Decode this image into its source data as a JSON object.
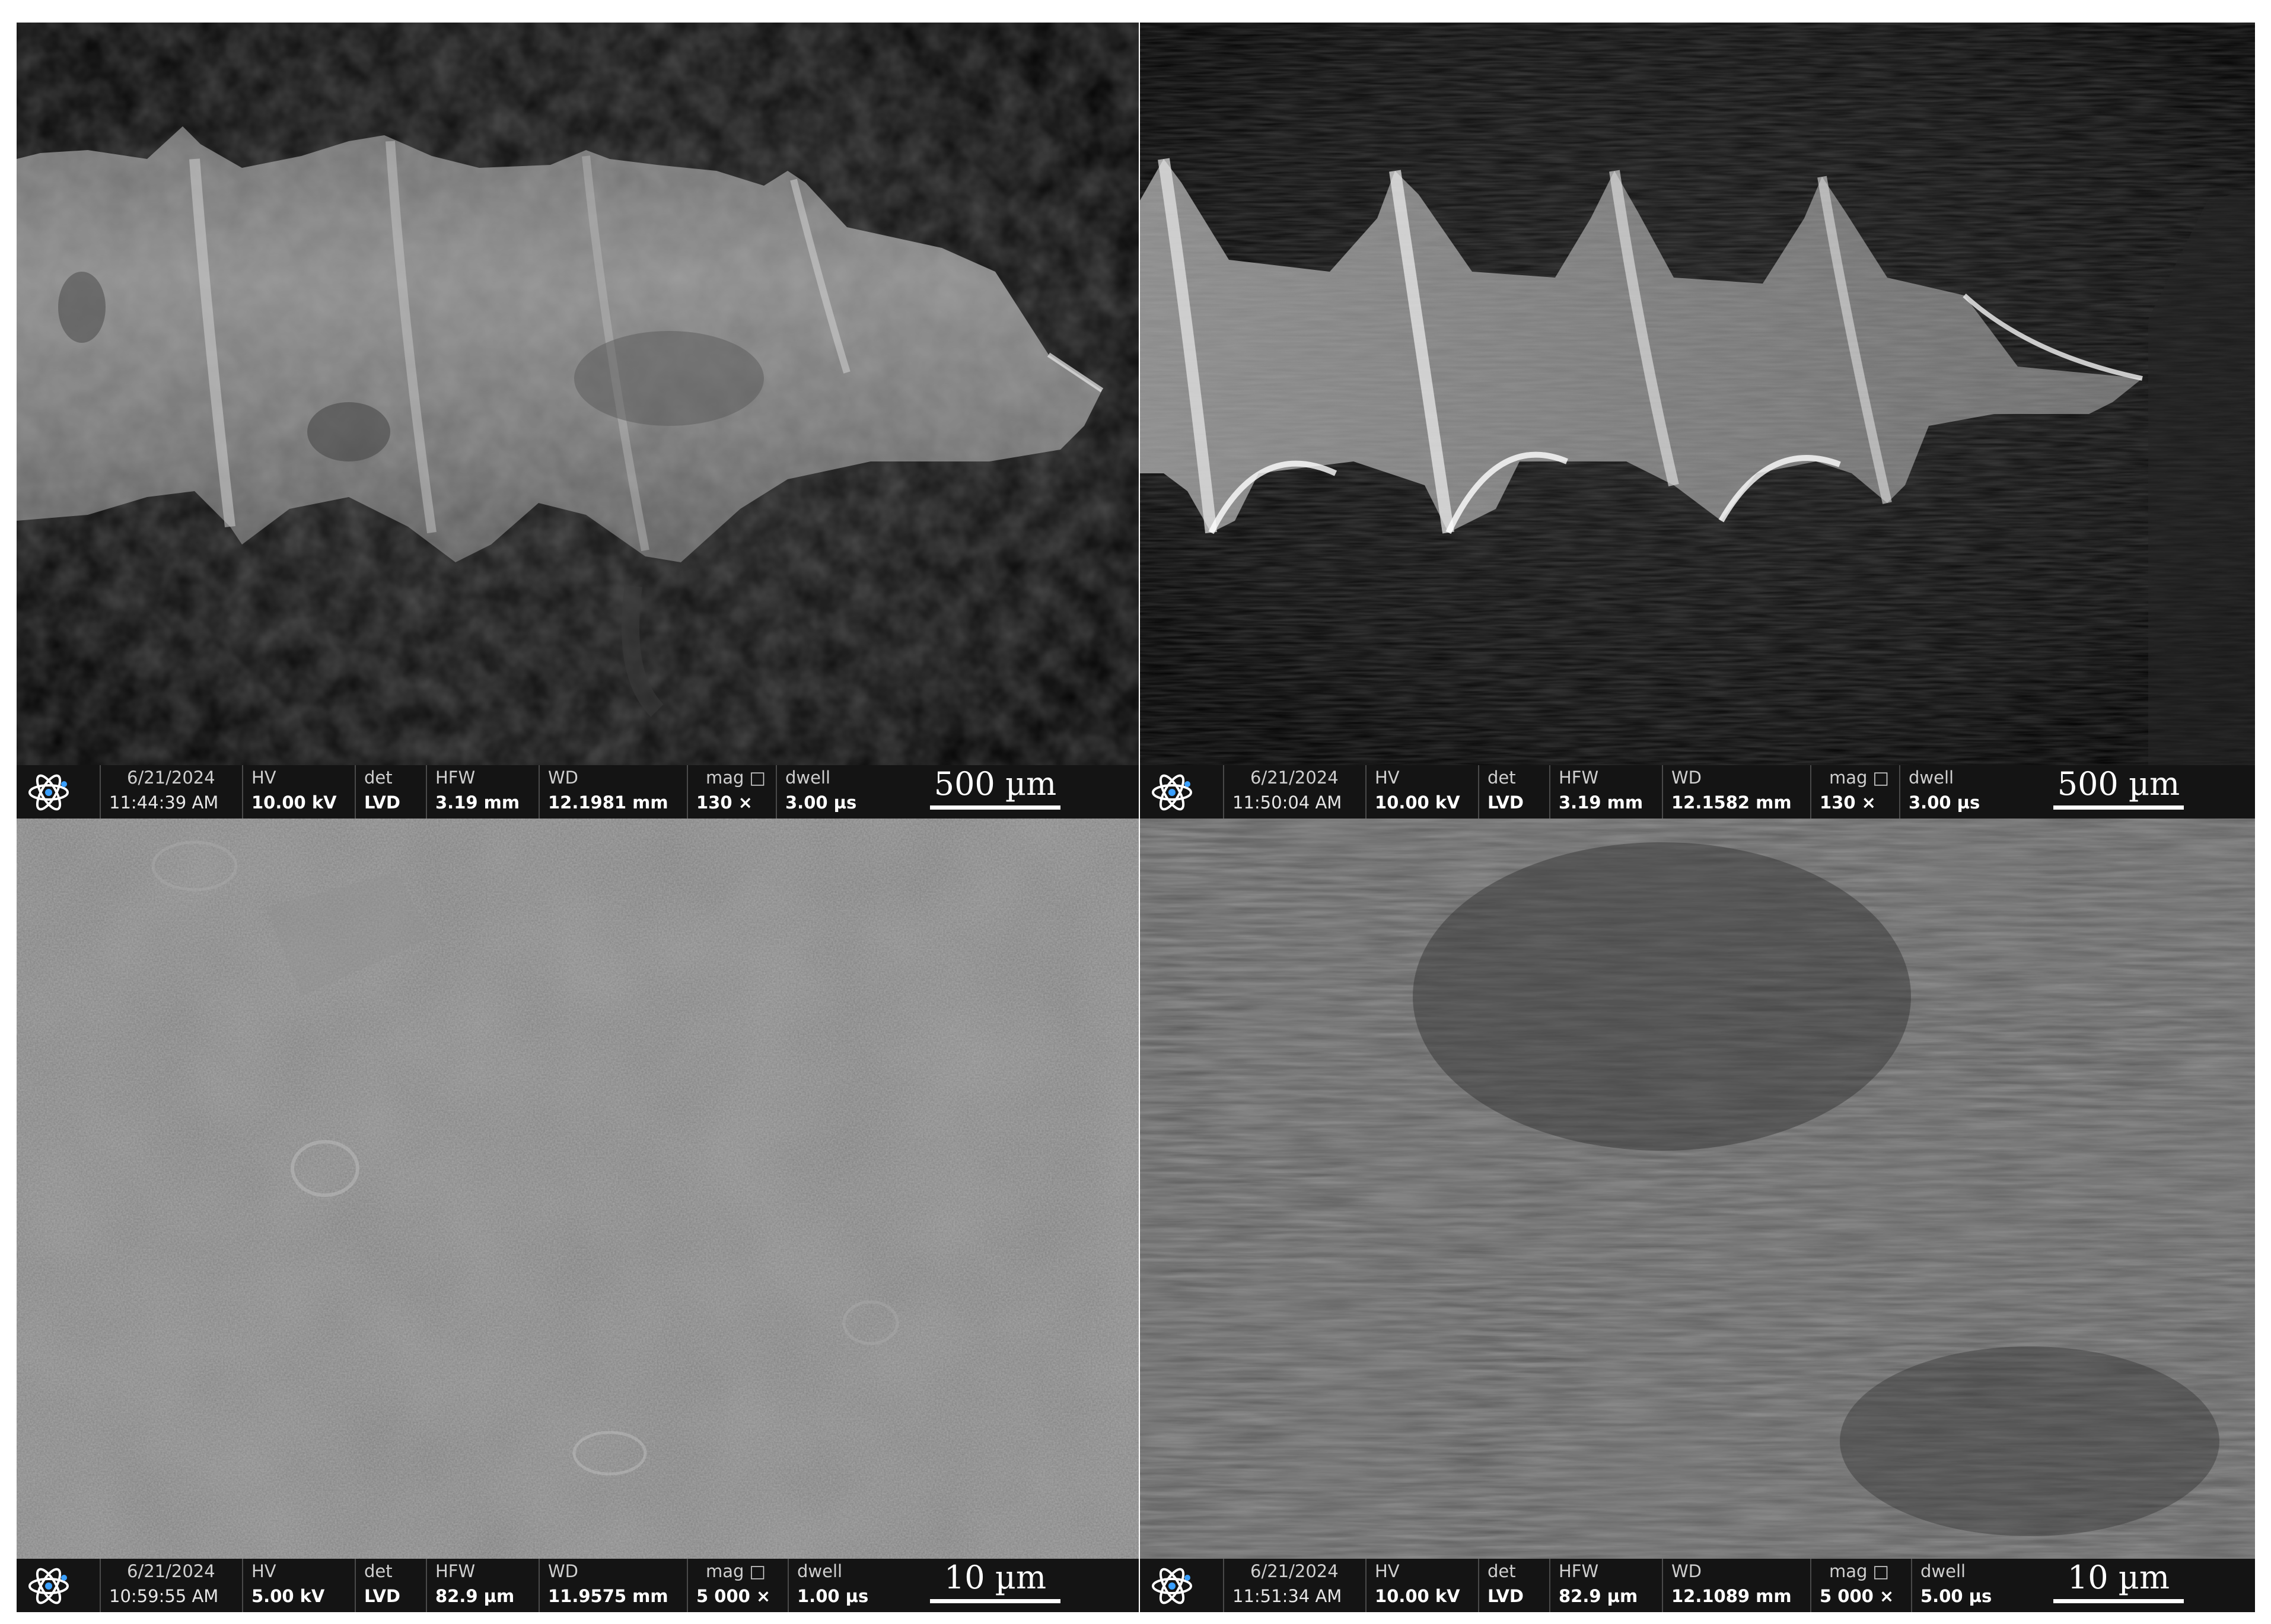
{
  "panels": [
    {
      "date": "6/21/2024",
      "time": "11:44:39 AM",
      "hv_label": "HV",
      "hv": "10.00 kV",
      "det_label": "det",
      "det": "LVD",
      "hfw_label": "HFW",
      "hfw": "3.19 mm",
      "wd_label": "WD",
      "wd": "12.1981 mm",
      "mag_label": "mag □",
      "mag": "130 ×",
      "dwell_label": "dwell",
      "dwell": "3.00 µs",
      "scale": "500 µm",
      "icon": "atom-logo-icon"
    },
    {
      "date": "6/21/2024",
      "time": "11:50:04 AM",
      "hv_label": "HV",
      "hv": "10.00 kV",
      "det_label": "det",
      "det": "LVD",
      "hfw_label": "HFW",
      "hfw": "3.19 mm",
      "wd_label": "WD",
      "wd": "12.1582 mm",
      "mag_label": "mag □",
      "mag": "130 ×",
      "dwell_label": "dwell",
      "dwell": "3.00 µs",
      "scale": "500 µm",
      "icon": "atom-logo-icon"
    },
    {
      "date": "6/21/2024",
      "time": "10:59:55 AM",
      "hv_label": "HV",
      "hv": "5.00 kV",
      "det_label": "det",
      "det": "LVD",
      "hfw_label": "HFW",
      "hfw": "82.9 µm",
      "wd_label": "WD",
      "wd": "11.9575 mm",
      "mag_label": "mag □",
      "mag": "5 000 ×",
      "dwell_label": "dwell",
      "dwell": "1.00 µs",
      "scale": "10 µm",
      "icon": "atom-logo-icon"
    },
    {
      "date": "6/21/2024",
      "time": "11:51:34 AM",
      "hv_label": "HV",
      "hv": "10.00 kV",
      "det_label": "det",
      "det": "LVD",
      "hfw_label": "HFW",
      "hfw": "82.9 µm",
      "wd_label": "WD",
      "wd": "12.1089 mm",
      "mag_label": "mag □",
      "mag": "5 000 ×",
      "dwell_label": "dwell",
      "dwell": "5.00 µs",
      "scale": "10 µm",
      "icon": "atom-logo-icon"
    }
  ],
  "colors": {
    "databar": "#141414",
    "text": "#ffffff",
    "logo": "#3aa0ff"
  }
}
